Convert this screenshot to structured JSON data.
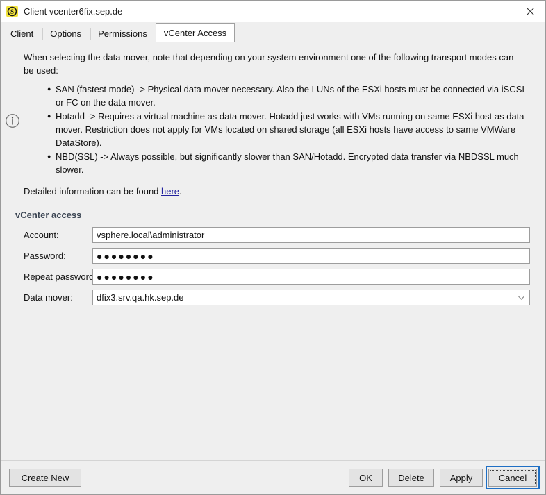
{
  "window": {
    "title": "Client vcenter6fix.sep.de",
    "app_icon": "sep-logo-icon",
    "close_icon": "close-icon"
  },
  "tabs": [
    {
      "label": "Client",
      "active": false
    },
    {
      "label": "Options",
      "active": false
    },
    {
      "label": "Permissions",
      "active": false
    },
    {
      "label": "vCenter Access",
      "active": true
    }
  ],
  "info": {
    "icon": "info-circle-icon",
    "intro": "When selecting the data mover, note that depending on your system environment one of the following transport modes can be used:",
    "bullets": [
      "SAN (fastest mode) -> Physical data mover necessary. Also the LUNs of the ESXi hosts must be connected via iSCSI or FC on the data mover.",
      "Hotadd -> Requires a virtual machine as data mover. Hotadd just works with VMs running on same ESXi host as data mover. Restriction does not apply for VMs located on shared storage (all ESXi hosts have access to same VMWare DataStore).",
      "NBD(SSL) -> Always possible, but significantly slower than SAN/Hotadd. Encrypted data transfer via NBDSSL much slower."
    ],
    "detail_prefix": "Detailed information can be found ",
    "detail_link": "here",
    "detail_suffix": "."
  },
  "group": {
    "title": "vCenter access"
  },
  "form": {
    "account": {
      "label": "Account:",
      "value": "vsphere.local\\administrator",
      "placeholder": ""
    },
    "password": {
      "label": "Password:",
      "value": "●●●●●●●●",
      "placeholder": ""
    },
    "repeat_password": {
      "label": "Repeat password:",
      "value": "●●●●●●●●",
      "placeholder": ""
    },
    "data_mover": {
      "label": "Data mover:",
      "value": "dfix3.srv.qa.hk.sep.de",
      "arrow_icon": "chevron-down-icon"
    }
  },
  "footer": {
    "create_new": "Create New",
    "ok": "OK",
    "delete": "Delete",
    "apply": "Apply",
    "cancel": "Cancel"
  },
  "colors": {
    "background": "#efefef",
    "titlebar": "#ffffff",
    "group_title": "#3a4452",
    "link": "#21219e",
    "focus_ring": "#1f6fc4",
    "icon_yellow": "#f2e33c",
    "field_border": "#9d9d9d"
  }
}
